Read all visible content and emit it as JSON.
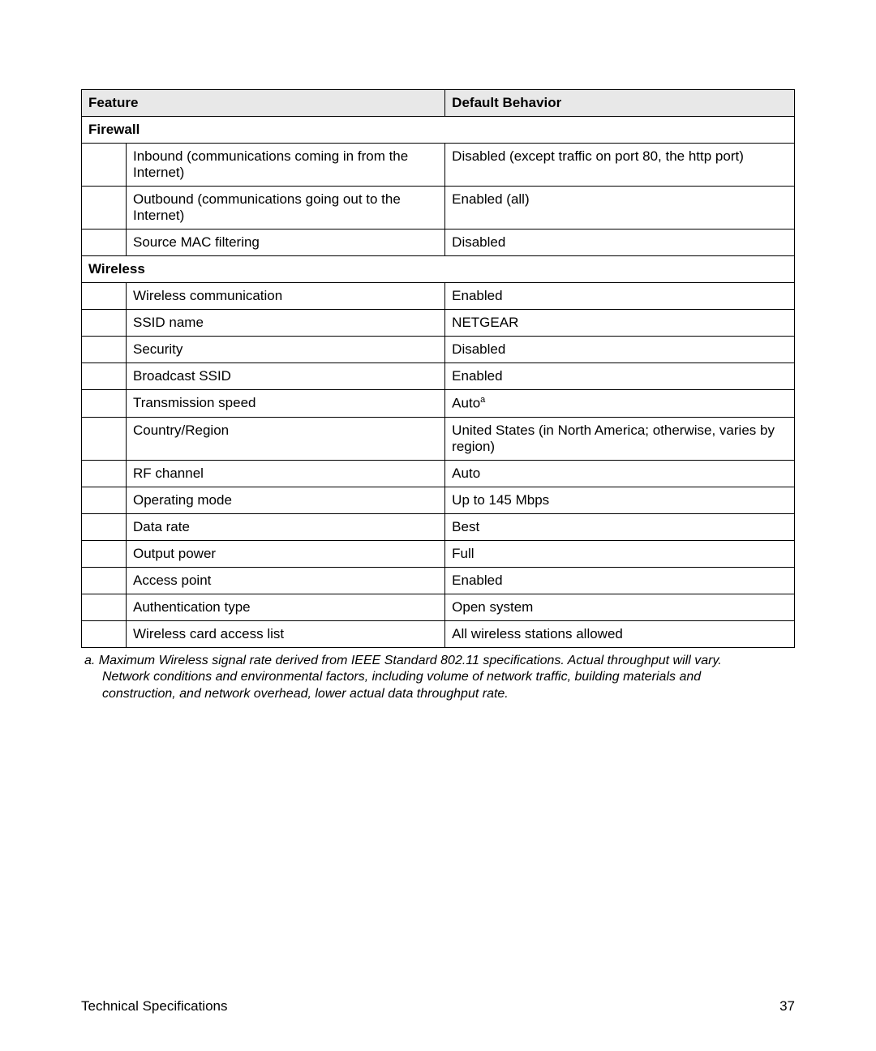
{
  "headers": {
    "feature": "Feature",
    "default": "Default Behavior"
  },
  "sections": {
    "firewall": {
      "title": "Firewall",
      "rows": [
        {
          "feature": "Inbound (communications coming in from the Internet)",
          "value": "Disabled (except traffic on port 80, the http port)"
        },
        {
          "feature": "Outbound (communications going out to the Internet)",
          "value": "Enabled (all)"
        },
        {
          "feature": "Source MAC filtering",
          "value": "Disabled"
        }
      ]
    },
    "wireless": {
      "title": "Wireless",
      "rows": [
        {
          "feature": "Wireless communication",
          "value": "Enabled"
        },
        {
          "feature": "SSID name",
          "value": "NETGEAR"
        },
        {
          "feature": "Security",
          "value": "Disabled"
        },
        {
          "feature": "Broadcast SSID",
          "value": "Enabled"
        },
        {
          "feature": "Transmission speed",
          "value": "Auto",
          "sup": "a"
        },
        {
          "feature": "Country/Region",
          "value": "United States (in North America; otherwise, varies by region)"
        },
        {
          "feature": "RF channel",
          "value": "Auto"
        },
        {
          "feature": "Operating mode",
          "value": "Up to 145 Mbps"
        },
        {
          "feature": "Data rate",
          "value": "Best"
        },
        {
          "feature": "Output power",
          "value": "Full"
        },
        {
          "feature": "Access point",
          "value": "Enabled"
        },
        {
          "feature": "Authentication type",
          "value": "Open system"
        },
        {
          "feature": "Wireless card access list",
          "value": "All wireless stations allowed"
        }
      ]
    }
  },
  "footnote": {
    "marker": "a.",
    "line1": "Maximum Wireless signal rate derived from IEEE Standard 802.11 specifications. Actual throughput will vary.",
    "line2": "Network conditions and environmental factors, including volume of network traffic, building materials and",
    "line3": "construction, and network overhead, lower actual data throughput rate."
  },
  "footer": {
    "left": "Technical Specifications",
    "right": "37"
  }
}
